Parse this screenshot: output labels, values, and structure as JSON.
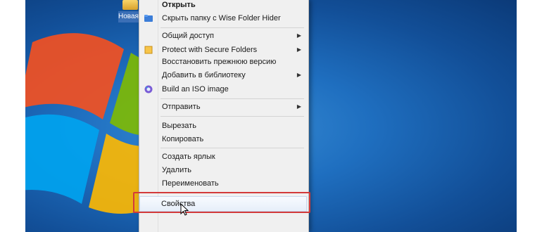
{
  "desktop": {
    "icon_label": "Новая"
  },
  "menu": {
    "items": [
      {
        "label": "Открыть",
        "bold": true
      },
      {
        "label": "Скрыть папку с Wise Folder Hider",
        "icon": "wise-folder-icon"
      },
      {
        "label": "Общий доступ",
        "submenu": true
      },
      {
        "label": "Protect with Secure Folders",
        "icon": "secure-folder-icon",
        "submenu": true
      },
      {
        "label": "Восстановить прежнюю версию"
      },
      {
        "label": "Добавить в библиотеку",
        "submenu": true
      },
      {
        "label": "Build an ISO image",
        "icon": "iso-disc-icon"
      },
      {
        "label": "Отправить",
        "submenu": true
      },
      {
        "label": "Вырезать"
      },
      {
        "label": "Копировать"
      },
      {
        "label": "Создать ярлык"
      },
      {
        "label": "Удалить"
      },
      {
        "label": "Переименовать"
      },
      {
        "label": "Свойства",
        "highlighted": true
      }
    ],
    "submenu_arrow": "▶"
  },
  "colors": {
    "highlight_border": "#d33a3a",
    "desktop_blue": "#1f6fc0"
  }
}
